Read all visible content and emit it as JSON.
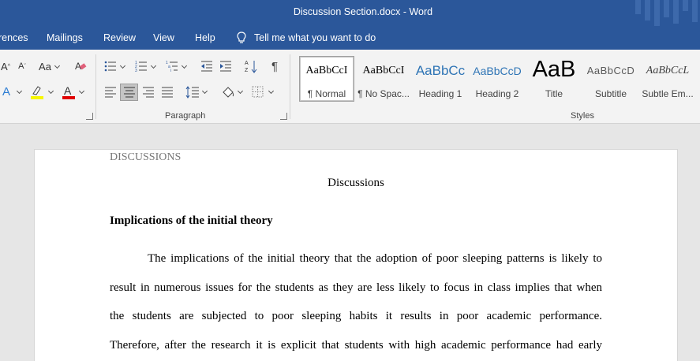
{
  "titlebar": {
    "title": "Discussion Section.docx  -  Word"
  },
  "menu": {
    "items": [
      "rences",
      "Mailings",
      "Review",
      "View",
      "Help"
    ],
    "tell_me": "Tell me what you want to do"
  },
  "ribbon": {
    "groups": {
      "paragraph": "Paragraph",
      "styles": "Styles"
    },
    "font_size_label": "Aa",
    "styles": [
      {
        "preview": "AaBbCcI",
        "name": "¶ Normal",
        "selected": true
      },
      {
        "preview": "AaBbCcI",
        "name": "¶ No Spac..."
      },
      {
        "preview": "AaBbCc",
        "name": "Heading 1"
      },
      {
        "preview": "AaBbCcD",
        "name": "Heading 2"
      },
      {
        "preview": "AaB",
        "name": "Title"
      },
      {
        "preview": "AaBbCcD",
        "name": "Subtitle"
      },
      {
        "preview": "AaBbCcL",
        "name": "Subtle Em..."
      }
    ],
    "colors": {
      "accent": "#2b579a",
      "highlight": "#f7f700",
      "font_color": "#e00000"
    }
  },
  "document": {
    "running_head": "DISCUSSIONS",
    "title": "Discussions",
    "heading": "Implications of the initial theory",
    "lines": [
      "The implications of the initial theory that the adoption of poor sleeping patterns is likely to",
      "result in numerous issues for the students as they are less likely to focus in class implies that when",
      "the students are subjected to poor sleeping habits it results in poor academic performance.",
      "Therefore, after the research it is explicit that students with high academic performance had early"
    ]
  }
}
